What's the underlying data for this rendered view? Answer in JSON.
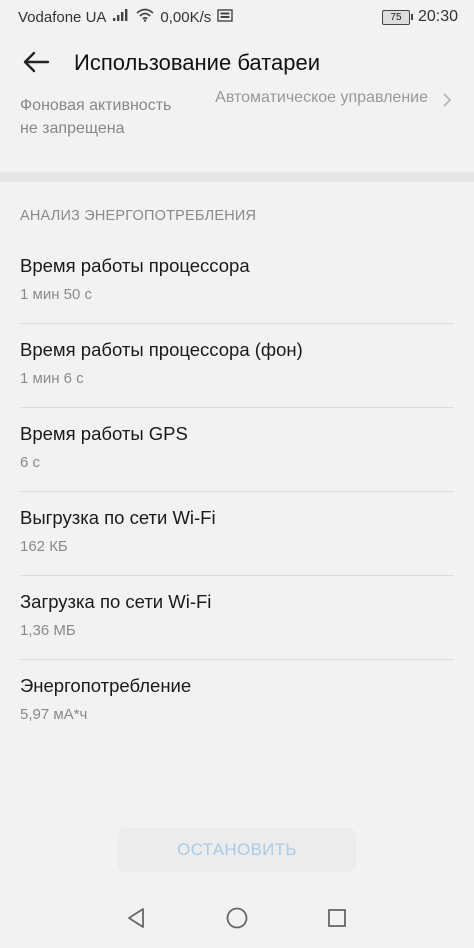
{
  "status_bar": {
    "carrier": "Vodafone UA",
    "net_speed": "0,00K/s",
    "battery_level": "75",
    "time": "20:30"
  },
  "header": {
    "title": "Использование батареи"
  },
  "background_activity": {
    "label": "Фоновая активность не запрещена",
    "value": "Автоматическое управление"
  },
  "section": {
    "title": "АНАЛИЗ ЭНЕРГОПОТРЕБЛЕНИЯ",
    "items": [
      {
        "label": "Время работы процессора",
        "value": "1 мин 50 с"
      },
      {
        "label": "Время работы процессора (фон)",
        "value": "1 мин 6 с"
      },
      {
        "label": "Время работы GPS",
        "value": "6 с"
      },
      {
        "label": "Выгрузка по сети Wi-Fi",
        "value": "162 КБ"
      },
      {
        "label": "Загрузка по сети Wi-Fi",
        "value": "1,36 МБ"
      },
      {
        "label": "Энергопотребление",
        "value": "5,97 мА*ч"
      }
    ]
  },
  "stop_button": {
    "label": "ОСТАНОВИТЬ"
  },
  "colors": {
    "accent_disabled": "#a9cbe9",
    "background": "#f2f2f2"
  },
  "icons": {
    "back": "arrow-left-icon",
    "chevron": "chevron-right-icon",
    "signal": "signal-icon",
    "wifi": "wifi-icon",
    "notification": "image-notification-icon",
    "nav_back": "triangle-back-icon",
    "nav_home": "circle-home-icon",
    "nav_recent": "square-recent-icon"
  }
}
